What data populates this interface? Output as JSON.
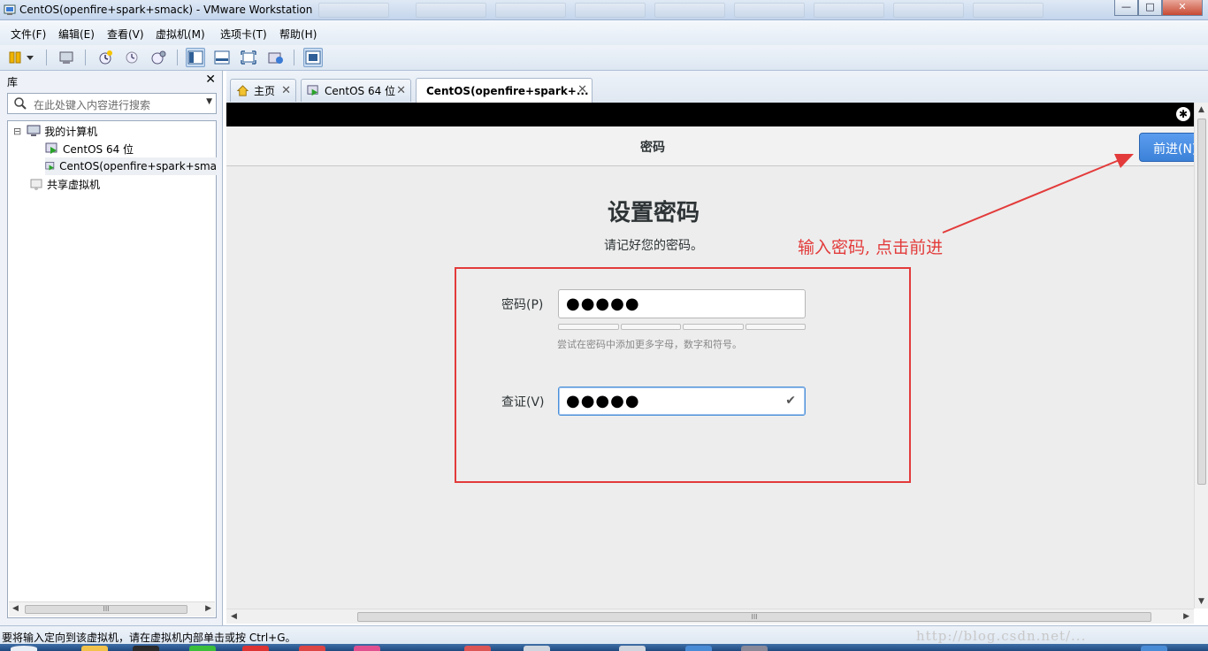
{
  "window": {
    "title": "CentOS(openfire+spark+smack) - VMware Workstation",
    "controls": {
      "minimize": "—",
      "maximize": "□",
      "close": "✕"
    }
  },
  "menu": [
    "文件(F)",
    "编辑(E)",
    "查看(V)",
    "虚拟机(M)",
    "选项卡(T)",
    "帮助(H)"
  ],
  "toolbar": {
    "icons": [
      "suspend-icon",
      "dropdown-icon",
      "send-ctrl-alt-del-icon",
      "snapshot-icon",
      "revert-snapshot-icon",
      "manage-snapshots-icon",
      "show-library-icon",
      "console-view-icon",
      "fullscreen-icon",
      "unity-icon",
      "thumbnail-view-icon"
    ]
  },
  "library": {
    "title": "库",
    "close": "✕",
    "search_placeholder": "在此处键入内容进行搜索",
    "tree": [
      {
        "label": "我的计算机",
        "toggle": "⊟"
      },
      {
        "label": "CentOS 64 位"
      },
      {
        "label": "CentOS(openfire+spark+sma"
      },
      {
        "label": "共享虚拟机"
      }
    ],
    "scroll_mid": "III"
  },
  "tabs": [
    {
      "label": "主页",
      "close": "✕"
    },
    {
      "label": "CentOS 64 位",
      "close": "✕"
    },
    {
      "label": "CentOS(openfire+spark+...",
      "close": "✕",
      "active": true
    }
  ],
  "vm": {
    "header_title": "密码",
    "next_button": "前进(N)",
    "heading": "设置密码",
    "subheading": "请记好您的密码。",
    "password_label": "密码(P)",
    "password_value": "●●●●●",
    "strength_hint": "尝试在密码中添加更多字母，数字和符号。",
    "confirm_label": "查证(V)",
    "confirm_value": "●●●●●",
    "confirm_check": "✔"
  },
  "annotation": {
    "text": "输入密码, 点击前进",
    "color": "#e33b3b"
  },
  "hscroll_mid": "III",
  "status": {
    "text": "要将输入定向到该虚拟机，请在虚拟机内部单击或按 Ctrl+G。",
    "watermark": "http://blog.csdn.net/..."
  },
  "colors": {
    "accent": "#3c82d9",
    "annotation_red": "#e33b3b"
  }
}
